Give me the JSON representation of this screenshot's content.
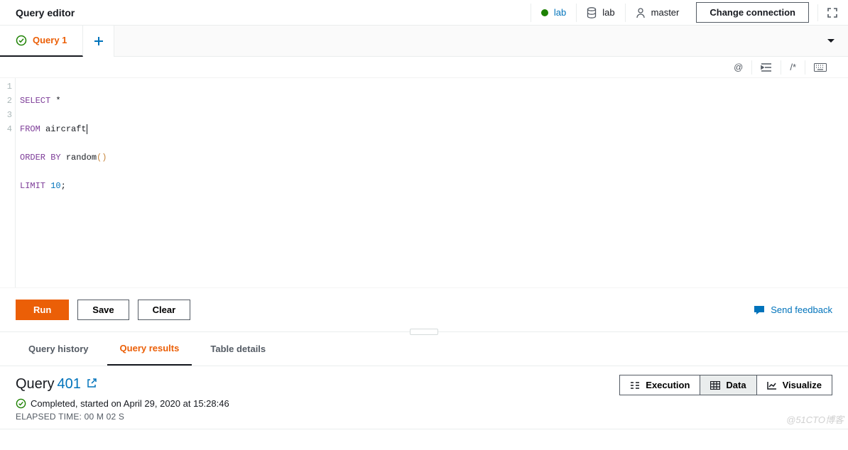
{
  "header": {
    "title": "Query editor",
    "conn_lab": "lab",
    "conn_db": "lab",
    "conn_user": "master",
    "change_btn": "Change connection"
  },
  "tabs": {
    "tab1_label": "Query 1"
  },
  "toolbar": {
    "at": "@",
    "comment": "/*"
  },
  "code": {
    "l1_kw": "SELECT",
    "l1_rest": " *",
    "l2_kw": "FROM",
    "l2_rest": " aircraft",
    "l3_kw1": "ORDER",
    "l3_kw2": "BY",
    "l3_fn": " random",
    "l3_p": "()",
    "l4_kw": "LIMIT",
    "l4_num": " 10",
    "l4_semi": ";",
    "ln1": "1",
    "ln2": "2",
    "ln3": "3",
    "ln4": "4"
  },
  "controls": {
    "run": "Run",
    "save": "Save",
    "clear": "Clear",
    "feedback": "Send feedback"
  },
  "result_tabs": {
    "history": "Query history",
    "results": "Query results",
    "details": "Table details"
  },
  "result": {
    "title_prefix": "Query ",
    "query_id": "401",
    "status_text": "Completed, started on April 29, 2020 at 15:28:46",
    "elapsed": "ELAPSED TIME: 00 m 02 s",
    "btn_execution": "Execution",
    "btn_data": "Data",
    "btn_visualize": "Visualize"
  },
  "watermark": "@51CTO博客"
}
